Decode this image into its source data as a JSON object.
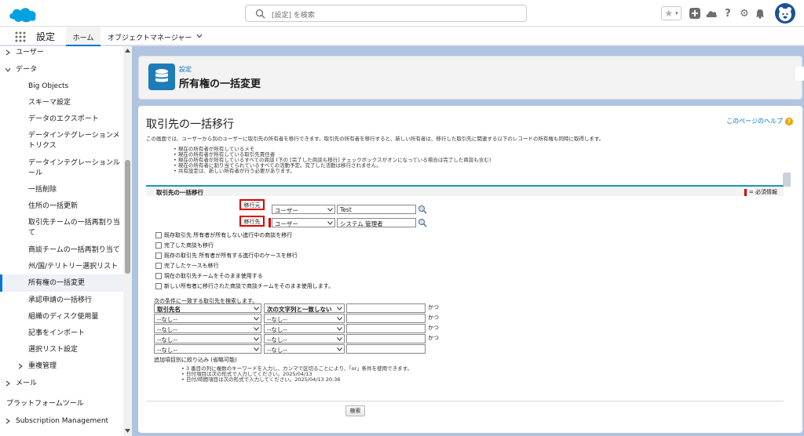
{
  "topbar": {
    "search_placeholder": "[設定] を検索"
  },
  "appbar": {
    "app_name": "設定",
    "tabs": [
      "ホーム",
      "オブジェクトマネージャー"
    ]
  },
  "sidebar": {
    "items": [
      {
        "label": "ユーザー",
        "arrow": "right"
      },
      {
        "label": "データ",
        "arrow": "down"
      },
      {
        "label": "Big Objects"
      },
      {
        "label": "スキーマ設定"
      },
      {
        "label": "データのエクスポート"
      },
      {
        "label": "データインテグレーションメ"
      },
      {
        "label": "トリクス"
      },
      {
        "label": "データインテグレーションル"
      },
      {
        "label": "ール"
      },
      {
        "label": "一括削除"
      },
      {
        "label": "住所の一括更新"
      },
      {
        "label": "取引先チームの一括再割り当"
      },
      {
        "label": "て"
      },
      {
        "label": "商談チームの一括再割り当て"
      },
      {
        "label": "州/国/テリトリー選択リスト"
      },
      {
        "label": "所有権の一括変更"
      },
      {
        "label": "承認申請の一括移行"
      },
      {
        "label": "組織のディスク使用量"
      },
      {
        "label": "記事をインポート"
      },
      {
        "label": "選択リスト設定"
      },
      {
        "label": "重複管理"
      },
      {
        "label": "メール"
      },
      {
        "label": "プラットフォームツール"
      },
      {
        "label": "Subscription Management"
      }
    ]
  },
  "header": {
    "subtitle": "設定",
    "title": "所有権の一括変更"
  },
  "main": {
    "title": "取引先の一括移行",
    "help_link": "このページのヘルプ",
    "intro": "この画面では、ユーザーから別のユーザーに取引先の所有者を移行できます。取引先の所有者を移行すると、新しい所有者は、移行した取引先に関連する以下のレコードの所有権も同時に取得します。",
    "bullets": [
      "現在の所有者が所有しているメモ",
      "現在の所有者が所有している取引先責任者",
      "現在の所有者が所有しているすべての商談 (下の [完了した商談も移行] チェックボックスがオンになっている場合は完了した商談も含む)",
      "現在の所有者に割り当てられているすべての活動予定。完了した活動は移行されません。",
      "共有設定は、新しい所有者が行う必要があります。"
    ],
    "section_title": "取引先の一括移行",
    "required_info": "= 必須情報",
    "from_label": "移行元",
    "to_label": "移行先",
    "from_type": "ユーザー",
    "from_value": "Test",
    "to_type": "ユーザー",
    "to_value": "システム 管理者",
    "checkboxes": [
      "既存取引先 所有者が所有しない進行中の商談を移行",
      "完了した商談も移行",
      "既存の取引先 所有者が所有する進行中のケースを移行",
      "完了したケースも移行",
      "現在の取引先チームをそのまま使用する",
      "新しい所有者に移行された商談で商談チームをそのまま使用します。"
    ],
    "filter_heading": "次の条件に一致する取引先を検索します。",
    "filters": [
      {
        "field": "取引先名",
        "op": "次の文字列と一致しない",
        "value": "",
        "and": "かつ"
      },
      {
        "field": "--なし--",
        "op": "--なし--",
        "value": "",
        "and": "かつ"
      },
      {
        "field": "--なし--",
        "op": "--なし--",
        "value": "",
        "and": "かつ"
      },
      {
        "field": "--なし--",
        "op": "--なし--",
        "value": "",
        "and": "かつ"
      },
      {
        "field": "--なし--",
        "op": "--なし--",
        "value": "",
        "and": ""
      }
    ],
    "additional": "追加項目別に絞り込み (省略可能)",
    "notes": [
      "3 番目の列に複数のキーワードを入力し、カンマで区切ることにより、「or」条件を使用できます。",
      "日付項目は次の形式で入力してください。2025/04/13",
      "日付/時間項目は次の形式で入力してください。2025/04/13 20:36"
    ],
    "search_button": "検索"
  },
  "colors": {
    "accent": "#0176d3",
    "required": "#cc0000",
    "highlight": "#e00000"
  }
}
